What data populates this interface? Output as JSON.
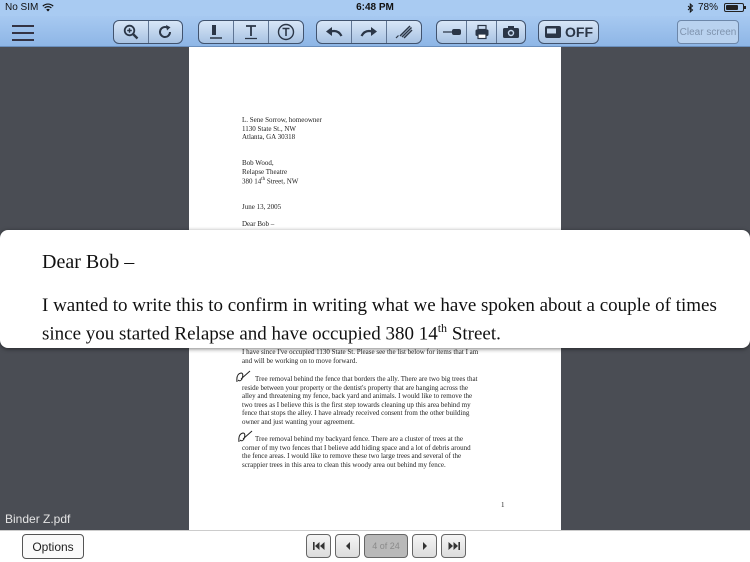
{
  "status": {
    "carrier": "No SIM",
    "time": "6:48 PM",
    "battery": "78%",
    "battery_level": 0.78
  },
  "toolbar": {
    "off_label": "OFF",
    "clear_label": "Clear screen"
  },
  "document": {
    "filename": "Binder Z.pdf",
    "sender": [
      "L. Sene Sorrow, homeowner",
      "1130 State St., NW",
      "Atlanta, GA 30318"
    ],
    "recipient_name": "Bob Wood,",
    "recipient_theatre": "Relapse Theatre",
    "recipient_street_pre": "380 14",
    "recipient_street_sup": "th",
    "recipient_street_post": " Street, NW",
    "date": "June 13, 2005",
    "salutation": "Dear Bob –",
    "para_intro": [
      "I have since I've occupied 1130 State St.  Please see the list below for items that I am",
      "and will be working on to move forward."
    ],
    "para_tree1": [
      "Tree removal behind the fence that borders the ally.  There are two big trees that",
      "reside between your property or the dentist's property that are hanging across the",
      "alley and threatening my fence, back yard and animals.  I would like to remove the",
      "two trees as I believe this is the first step towards cleaning up this area behind my",
      "fence that stops the alley.  I have already received consent from the other building",
      "owner and just wanting your agreement."
    ],
    "para_tree2": [
      "Tree removal behind my backyard fence.  There are a cluster of trees at the",
      "corner of my two fences that I believe add hiding space and a lot of debris around",
      "the fence areas.  I would like to remove these two large trees and several of the",
      "scrappier trees in this area to clean this woody area out behind my fence."
    ],
    "page_number": "1"
  },
  "zoom": {
    "greeting": "Dear Bob –",
    "body_pre": "I wanted to write this to confirm in writing what we have spoken about a couple of times since you started Relapse and have occupied 380 14",
    "body_sup": "th",
    "body_post": " Street."
  },
  "bottom": {
    "options_label": "Options",
    "page_indicator": "4 of 24"
  }
}
